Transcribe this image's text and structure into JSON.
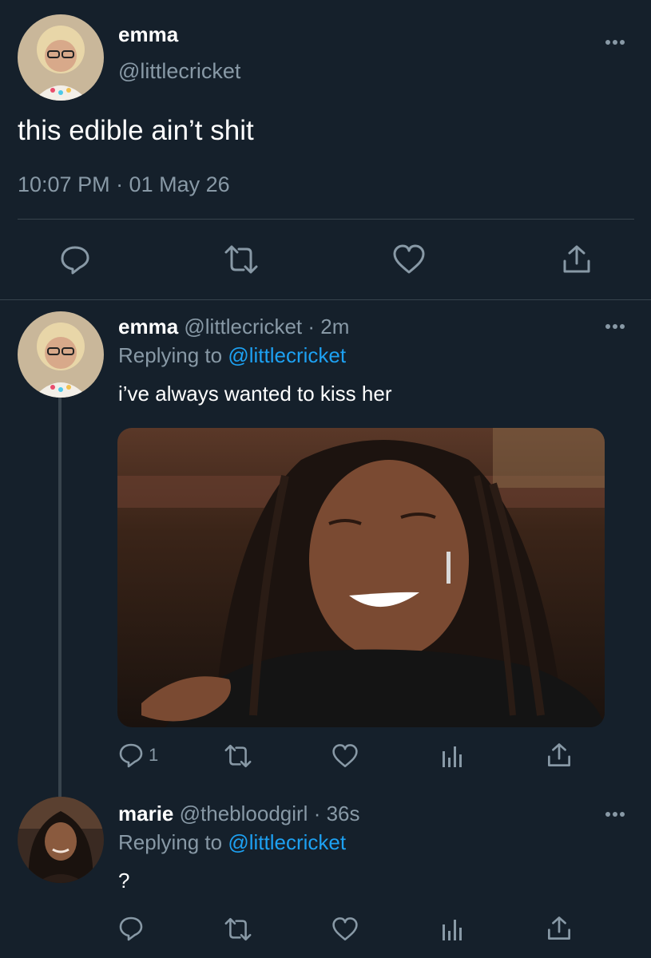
{
  "main_tweet": {
    "author_name": "emma",
    "author_handle": "@littlecricket",
    "text": "this edible ain’t shit",
    "timestamp": "10:07 PM · 01 May 26",
    "avatar_icon": "avatar-photo",
    "actions": [
      "reply-icon",
      "retweet-icon",
      "like-icon",
      "share-icon"
    ]
  },
  "replies": [
    {
      "author_name": "emma",
      "author_handle": "@littlecricket",
      "time_ago": "· 2m",
      "replying_prefix": "Replying to",
      "replying_to": "@littlecricket",
      "text": "i’ve always wanted to kiss her",
      "reply_count": "1",
      "has_media": true
    },
    {
      "author_name": "marie",
      "author_handle": "@thebloodgirl",
      "time_ago": "· 36s",
      "replying_prefix": "Replying to",
      "replying_to": "@littlecricket",
      "text": "?",
      "has_media": false
    }
  ],
  "colors": {
    "background": "#15202b",
    "muted_text": "#8899a6",
    "link": "#1da1f2",
    "divider": "#38444d"
  }
}
